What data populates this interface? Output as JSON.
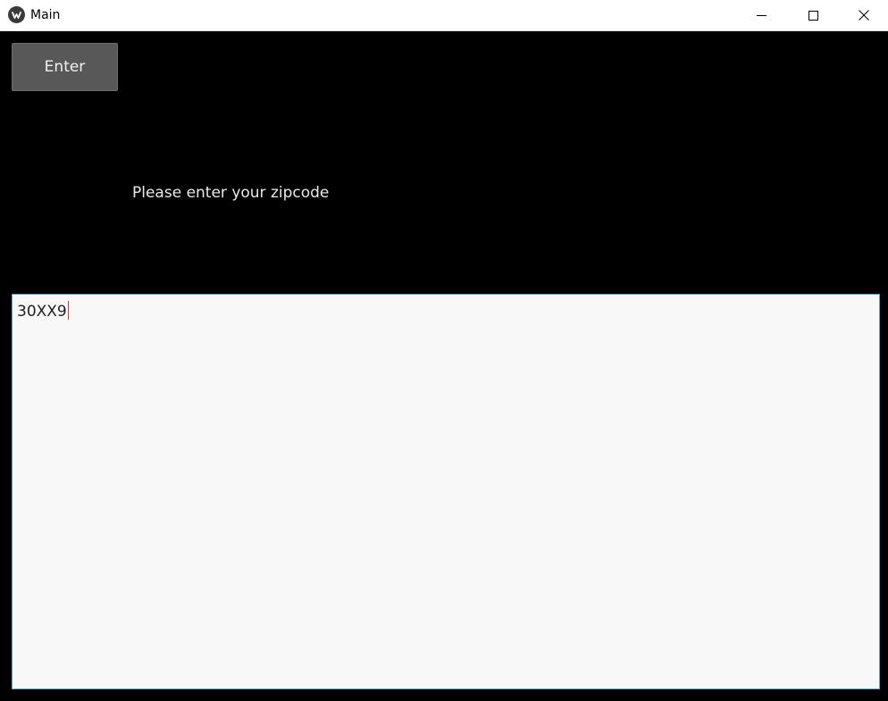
{
  "window": {
    "title": "Main"
  },
  "icons": {
    "app": "kivy-logo-icon",
    "minimize": "minimize-icon",
    "maximize": "maximize-icon",
    "close": "close-icon"
  },
  "form": {
    "enter_label": "Enter",
    "prompt": "Please enter your zipcode",
    "zip_value": "30XX9"
  },
  "colors": {
    "background": "#000000",
    "button": "#585858",
    "input_border": "#4ea7d4",
    "caret": "#d9362c"
  }
}
